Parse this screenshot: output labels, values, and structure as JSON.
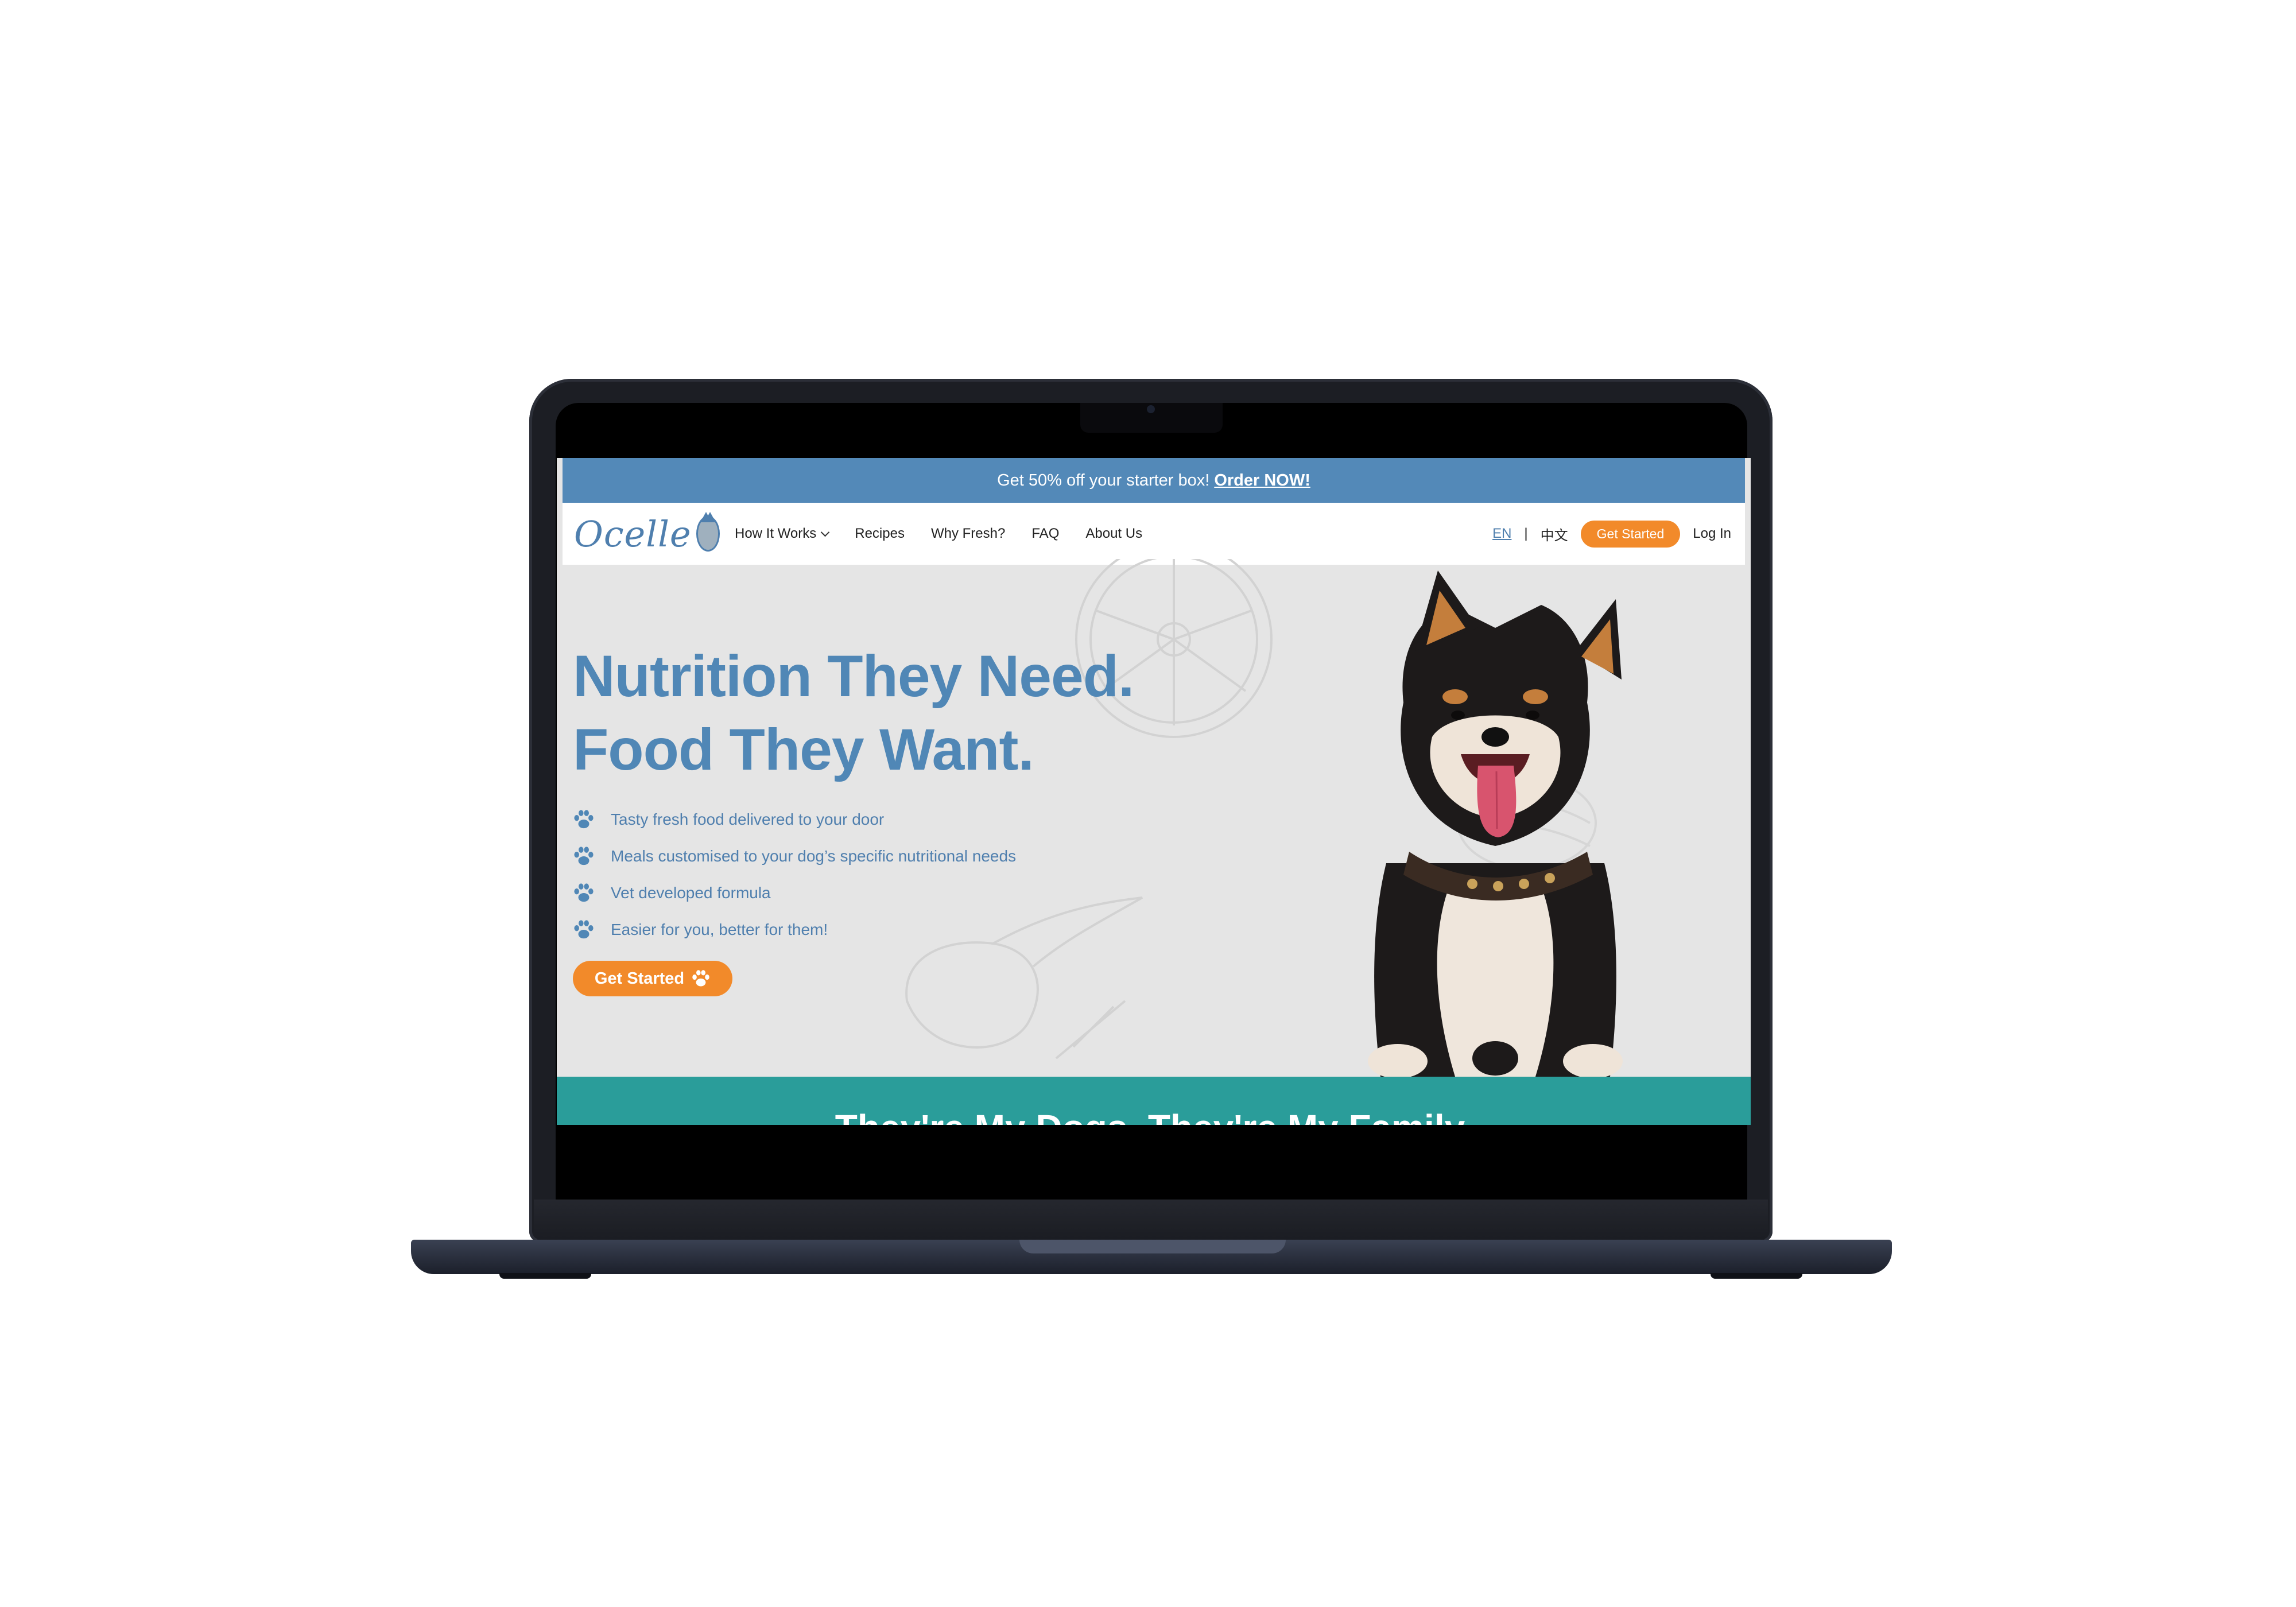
{
  "promo": {
    "text": "Get 50% off your starter box!",
    "link": "Order NOW!"
  },
  "brand": {
    "name": "Ocelle"
  },
  "nav": {
    "links": [
      "How It Works",
      "Recipes",
      "Why Fresh?",
      "FAQ",
      "About Us"
    ],
    "lang_en": "EN",
    "lang_sep": "|",
    "lang_zh": "中文",
    "cta": "Get Started",
    "login": "Log In"
  },
  "hero": {
    "headline_line1": "Nutrition They Need.",
    "headline_line2": "Food They Want.",
    "features": [
      "Tasty fresh food delivered to your door",
      "Meals customised to your dog’s specific nutritional needs",
      "Vet developed formula",
      "Easier for you, better for them!"
    ],
    "cta": "Get Started"
  },
  "next_section": {
    "title": "They're My Dogs. They're My Family."
  },
  "colors": {
    "primary": "#5087b6",
    "accent": "#f28a2a",
    "teal": "#2a9d9a",
    "laptop": "#1c1e24"
  }
}
